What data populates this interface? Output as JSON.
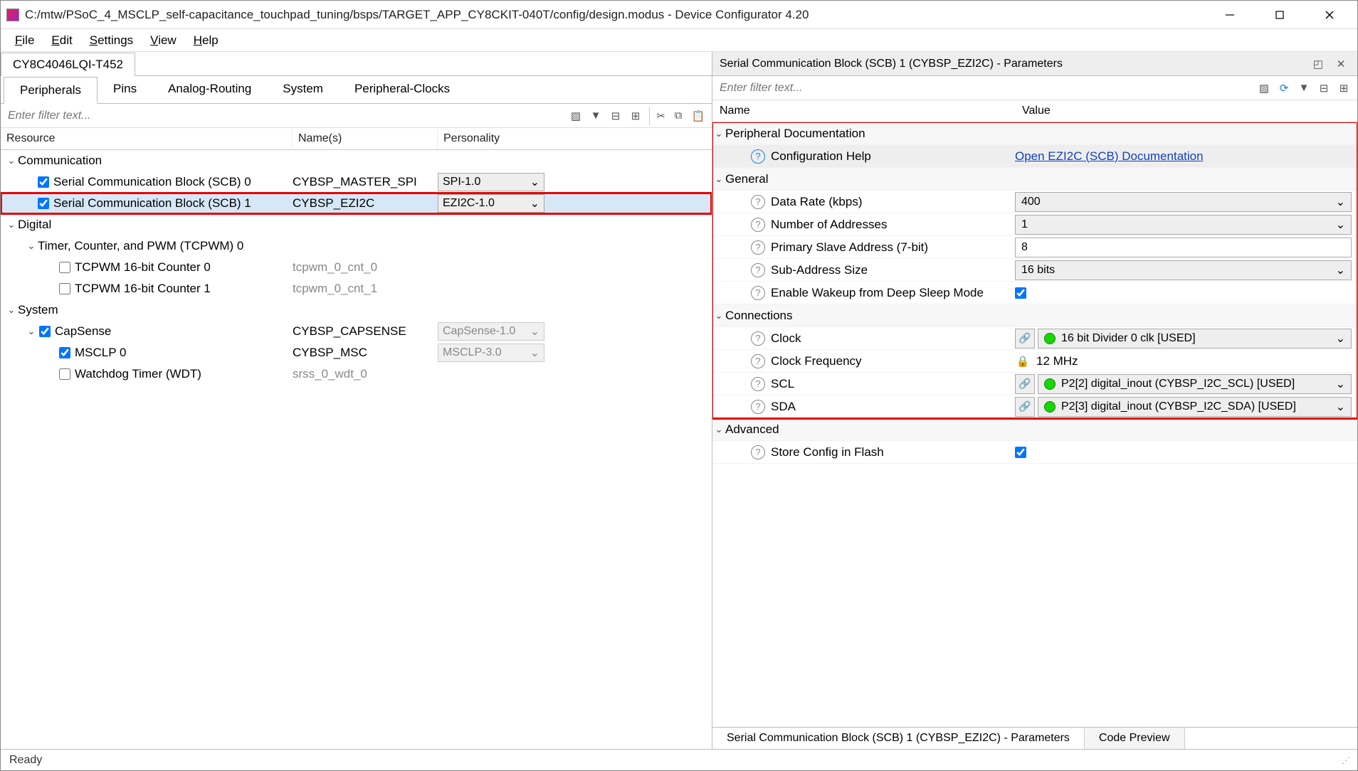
{
  "window": {
    "title": "C:/mtw/PSoC_4_MSCLP_self-capacitance_touchpad_tuning/bsps/TARGET_APP_CY8CKIT-040T/config/design.modus - Device Configurator 4.20"
  },
  "menus": [
    "File",
    "Edit",
    "Settings",
    "View",
    "Help"
  ],
  "deviceTab": "CY8C4046LQI-T452",
  "subTabs": [
    "Peripherals",
    "Pins",
    "Analog-Routing",
    "System",
    "Peripheral-Clocks"
  ],
  "filterPlaceholder": "Enter filter text...",
  "leftCols": {
    "resource": "Resource",
    "names": "Name(s)",
    "personality": "Personality"
  },
  "tree": {
    "communication": {
      "label": "Communication",
      "scb0": {
        "label": "Serial Communication Block (SCB) 0",
        "checked": true,
        "name": "CYBSP_MASTER_SPI",
        "personality": "SPI-1.0"
      },
      "scb1": {
        "label": "Serial Communication Block (SCB) 1",
        "checked": true,
        "name": "CYBSP_EZI2C",
        "personality": "EZI2C-1.0"
      }
    },
    "digital": {
      "label": "Digital",
      "tcpwm": {
        "label": "Timer, Counter, and PWM (TCPWM) 0",
        "cnt0": {
          "label": "TCPWM 16-bit Counter 0",
          "checked": false,
          "name": "tcpwm_0_cnt_0"
        },
        "cnt1": {
          "label": "TCPWM 16-bit Counter 1",
          "checked": false,
          "name": "tcpwm_0_cnt_1"
        }
      }
    },
    "system": {
      "label": "System",
      "capsense": {
        "label": "CapSense",
        "checked": true,
        "name": "CYBSP_CAPSENSE",
        "personality": "CapSense-1.0"
      },
      "msclp": {
        "label": "MSCLP 0",
        "checked": true,
        "name": "CYBSP_MSC",
        "personality": "MSCLP-3.0"
      },
      "wdt": {
        "label": "Watchdog Timer (WDT)",
        "checked": false,
        "name": "srss_0_wdt_0"
      }
    }
  },
  "rightPanel": {
    "title": "Serial Communication Block (SCB) 1 (CYBSP_EZI2C) - Parameters",
    "filterPlaceholder": "Enter filter text...",
    "cols": {
      "name": "Name",
      "value": "Value"
    },
    "groups": {
      "doc": {
        "label": "Peripheral Documentation",
        "configHelp": "Configuration Help",
        "docLink": "Open EZI2C (SCB) Documentation"
      },
      "general": {
        "label": "General",
        "dataRate": {
          "label": "Data Rate (kbps)",
          "value": "400"
        },
        "numAddr": {
          "label": "Number of Addresses",
          "value": "1"
        },
        "primAddr": {
          "label": "Primary Slave Address (7-bit)",
          "value": "8"
        },
        "subAddr": {
          "label": "Sub-Address Size",
          "value": "16 bits"
        },
        "wake": {
          "label": "Enable Wakeup from Deep Sleep Mode",
          "checked": true
        }
      },
      "conn": {
        "label": "Connections",
        "clock": {
          "label": "Clock",
          "value": "16 bit Divider 0 clk [USED]"
        },
        "clkFreq": {
          "label": "Clock Frequency",
          "value": "12 MHz"
        },
        "scl": {
          "label": "SCL",
          "value": "P2[2] digital_inout (CYBSP_I2C_SCL) [USED]"
        },
        "sda": {
          "label": "SDA",
          "value": "P2[3] digital_inout (CYBSP_I2C_SDA) [USED]"
        }
      },
      "adv": {
        "label": "Advanced",
        "store": {
          "label": "Store Config in Flash",
          "checked": true
        }
      }
    },
    "bottomTabs": {
      "params": "Serial Communication Block (SCB) 1 (CYBSP_EZI2C) - Parameters",
      "code": "Code Preview"
    }
  },
  "status": "Ready"
}
